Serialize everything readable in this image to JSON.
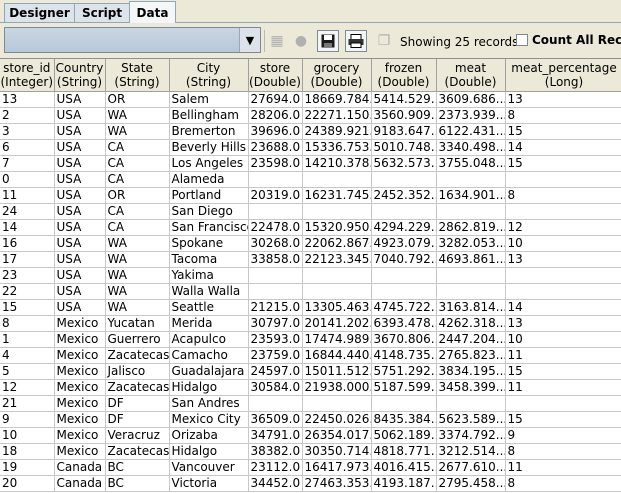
{
  "tabs": [
    {
      "label": "Designer",
      "active": false
    },
    {
      "label": "Script",
      "active": false
    },
    {
      "label": "Data",
      "active": true
    }
  ],
  "toolbar": {
    "showing": "Showing 25 records",
    "count_all": "Count All Records",
    "icons": [
      "grid-icon",
      "stop-icon",
      "save-icon",
      "print-icon",
      "copy-icon"
    ]
  },
  "columns": [
    {
      "name": "store_id",
      "type": "(Integer)"
    },
    {
      "name": "Country",
      "type": "(String)"
    },
    {
      "name": "State",
      "type": "(String)"
    },
    {
      "name": "City",
      "type": "(String)"
    },
    {
      "name": "store",
      "type": "(Double)"
    },
    {
      "name": "grocery",
      "type": "(Double)"
    },
    {
      "name": "frozen",
      "type": "(Double)"
    },
    {
      "name": "meat",
      "type": "(Double)"
    },
    {
      "name": "meat_percentage",
      "type": "(Long)"
    }
  ],
  "rows": [
    [
      "13",
      "USA",
      "OR",
      "Salem",
      "27694.0",
      "18669.784...",
      "5414.529...",
      "3609.686...",
      "13"
    ],
    [
      "2",
      "USA",
      "WA",
      "Bellingham",
      "28206.0",
      "22271.150...",
      "3560.909...",
      "2373.939...",
      "8"
    ],
    [
      "3",
      "USA",
      "WA",
      "Bremerton",
      "39696.0",
      "24389.921...",
      "9183.647...",
      "6122.431...",
      "15"
    ],
    [
      "6",
      "USA",
      "CA",
      "Beverly Hills",
      "23688.0",
      "15336.753...",
      "5010.748...",
      "3340.498...",
      "14"
    ],
    [
      "7",
      "USA",
      "CA",
      "Los Angeles",
      "23598.0",
      "14210.378...",
      "5632.573...",
      "3755.048...",
      "15"
    ],
    [
      "0",
      "USA",
      "CA",
      "Alameda",
      "",
      "",
      "",
      "",
      ""
    ],
    [
      "11",
      "USA",
      "OR",
      "Portland",
      "20319.0",
      "16231.745...",
      "2452.352...",
      "1634.901...",
      "8"
    ],
    [
      "24",
      "USA",
      "CA",
      "San Diego",
      "",
      "",
      "",
      "",
      ""
    ],
    [
      "14",
      "USA",
      "CA",
      "San Francisco",
      "22478.0",
      "15320.950...",
      "4294.229...",
      "2862.819...",
      "12"
    ],
    [
      "16",
      "USA",
      "WA",
      "Spokane",
      "30268.0",
      "22062.867...",
      "4923.079...",
      "3282.053...",
      "10"
    ],
    [
      "17",
      "USA",
      "WA",
      "Tacoma",
      "33858.0",
      "22123.345...",
      "7040.792...",
      "4693.861...",
      "13"
    ],
    [
      "23",
      "USA",
      "WA",
      "Yakima",
      "",
      "",
      "",
      "",
      ""
    ],
    [
      "22",
      "USA",
      "WA",
      "Walla Walla",
      "",
      "",
      "",
      "",
      ""
    ],
    [
      "15",
      "USA",
      "WA",
      "Seattle",
      "21215.0",
      "13305.463...",
      "4745.722...",
      "3163.814...",
      "14"
    ],
    [
      "8",
      "Mexico",
      "Yucatan",
      "Merida",
      "30797.0",
      "20141.202...",
      "6393.478...",
      "4262.318...",
      "13"
    ],
    [
      "1",
      "Mexico",
      "Guerrero",
      "Acapulco",
      "23593.0",
      "17474.989...",
      "3670.806...",
      "2447.204...",
      "10"
    ],
    [
      "4",
      "Mexico",
      "Zacatecas",
      "Camacho",
      "23759.0",
      "16844.440...",
      "4148.735...",
      "2765.823...",
      "11"
    ],
    [
      "5",
      "Mexico",
      "Jalisco",
      "Guadalajara",
      "24597.0",
      "15011.512...",
      "5751.292...",
      "3834.195...",
      "15"
    ],
    [
      "12",
      "Mexico",
      "Zacatecas",
      "Hidalgo",
      "30584.0",
      "21938.000...",
      "5187.599...",
      "3458.399...",
      "11"
    ],
    [
      "21",
      "Mexico",
      "DF",
      "San Andres",
      "",
      "",
      "",
      "",
      ""
    ],
    [
      "9",
      "Mexico",
      "DF",
      "Mexico City",
      "36509.0",
      "22450.026...",
      "8435.384...",
      "5623.589...",
      "15"
    ],
    [
      "10",
      "Mexico",
      "Veracruz",
      "Orizaba",
      "34791.0",
      "26354.017...",
      "5062.189...",
      "3374.792...",
      "9"
    ],
    [
      "18",
      "Mexico",
      "Zacatecas",
      "Hidalgo",
      "38382.0",
      "30350.714...",
      "4818.771...",
      "3212.514...",
      "8"
    ],
    [
      "19",
      "Canada",
      "BC",
      "Vancouver",
      "23112.0",
      "16417.973...",
      "4016.415...",
      "2677.610...",
      "11"
    ],
    [
      "20",
      "Canada",
      "BC",
      "Victoria",
      "34452.0",
      "27463.353...",
      "4193.187...",
      "2795.458...",
      "8"
    ]
  ]
}
